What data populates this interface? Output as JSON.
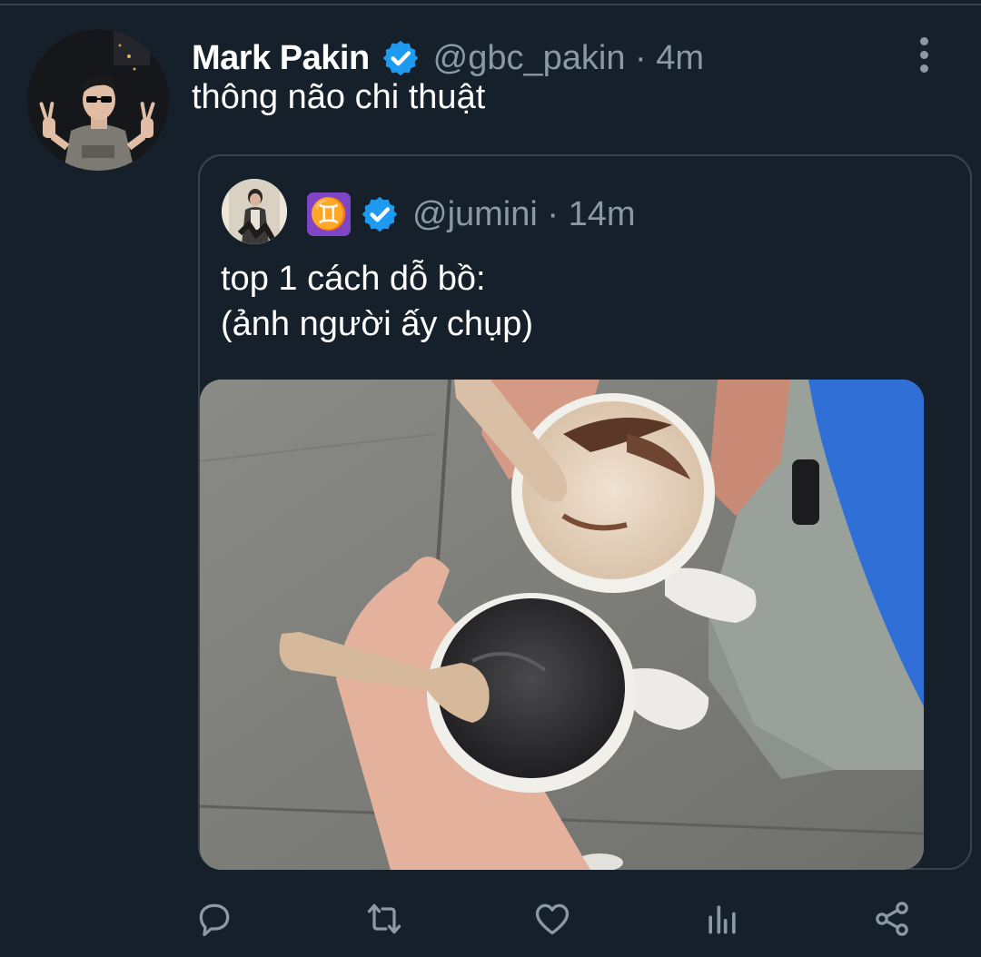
{
  "tweet": {
    "display_name": "Mark Pakin",
    "handle": "@gbc_pakin",
    "separator": "·",
    "time": "4m",
    "text": "thông não chi thuật",
    "verified": true
  },
  "quoted_tweet": {
    "badge_symbol": "♊",
    "badge_color": "#7f45c6",
    "handle": "@jumini",
    "separator": "·",
    "time": "14m",
    "text_line_1": "top 1 cách dỗ bồ:",
    "text_line_2": "(ảnh người ấy chụp)",
    "verified": true,
    "media": "photo-two-ice-cream-cups"
  },
  "actions": [
    {
      "name": "reply",
      "icon": "reply-icon"
    },
    {
      "name": "retweet",
      "icon": "retweet-icon"
    },
    {
      "name": "like",
      "icon": "heart-icon"
    },
    {
      "name": "analytics",
      "icon": "analytics-icon"
    },
    {
      "name": "share",
      "icon": "share-icon"
    }
  ],
  "colors": {
    "background": "#15202b",
    "border": "#38444d",
    "secondary_text": "#8b98a5",
    "verified_blue": "#1d9bf0",
    "primary_text": "#ffffff"
  }
}
